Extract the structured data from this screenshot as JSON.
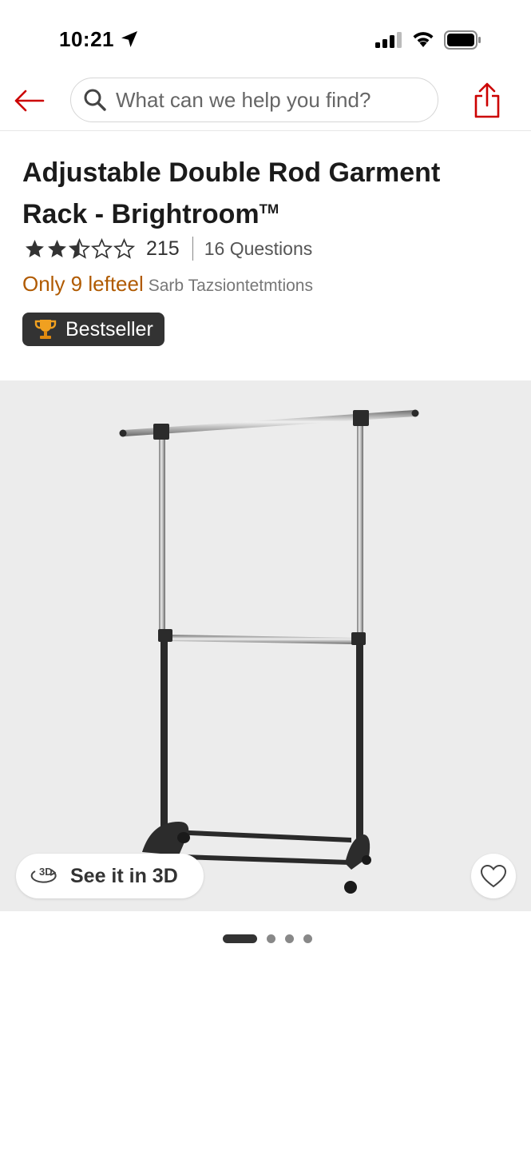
{
  "status_bar": {
    "time": "10:21"
  },
  "search": {
    "placeholder": "What can we help you find?"
  },
  "product": {
    "title": "Adjustable Double Rod Garment Rack - Brightroom",
    "trademark": "TM",
    "rating_value": 2.5,
    "rating_max": 5,
    "rating_count": "215",
    "questions": "16 Questions",
    "stock_text": "Only 9 lefteel",
    "stock_extra": "Sarb Tazsiontetmtions",
    "badge": "Bestseller"
  },
  "gallery": {
    "see_3d_label": "See it in 3D",
    "pages": 4,
    "active_page": 1
  },
  "colors": {
    "accent_red": "#cc0000",
    "stock_orange": "#b05a00",
    "badge_bg": "#333333",
    "trophy": "#f0a020"
  },
  "icons": {
    "back": "arrow-left-icon",
    "search": "search-icon",
    "share": "share-icon",
    "trophy": "trophy-icon",
    "3d": "3d-rotate-icon",
    "favorite": "heart-icon"
  }
}
